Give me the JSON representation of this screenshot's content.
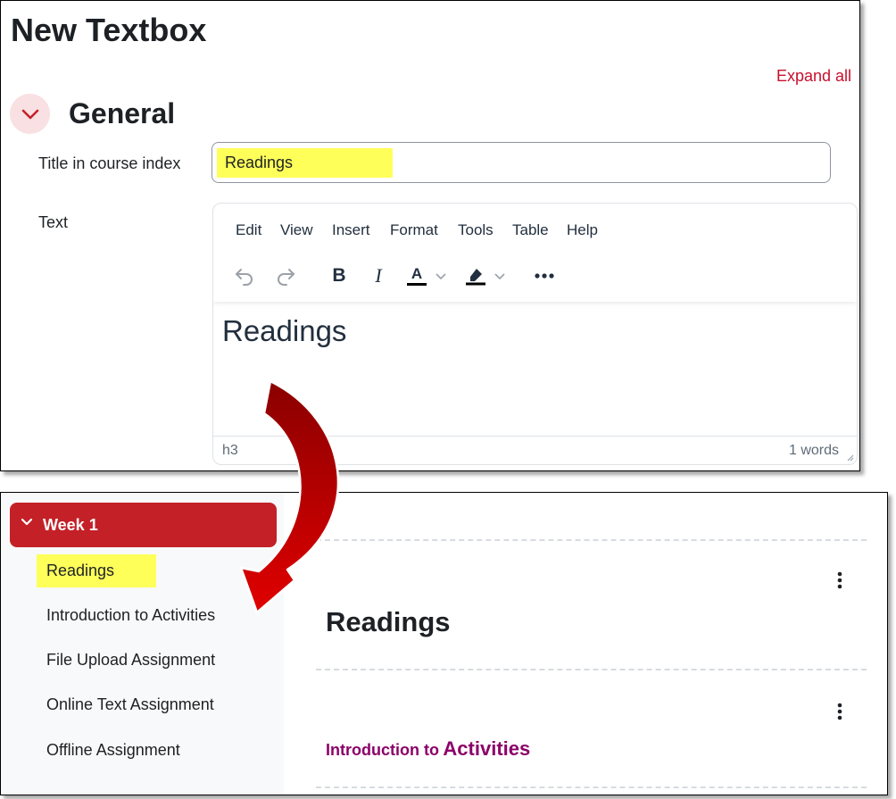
{
  "page_title": "New Textbox",
  "expand_all": "Expand all",
  "section": {
    "title": "General"
  },
  "fields": {
    "title_label": "Title in course index",
    "title_value": "Readings",
    "text_label": "Text"
  },
  "editor": {
    "menus": [
      "Edit",
      "View",
      "Insert",
      "Format",
      "Tools",
      "Table",
      "Help"
    ],
    "toolbar_icons": [
      "undo-icon",
      "redo-icon",
      "bold-icon",
      "italic-icon",
      "text-color-icon",
      "highlight-color-icon",
      "more-icon"
    ],
    "bold_glyph": "B",
    "italic_glyph": "I",
    "text_color_glyph": "A",
    "content_heading": "Readings",
    "status_path": "h3",
    "word_count": "1 words"
  },
  "course_index": {
    "week_label": "Week 1",
    "items": [
      "Readings",
      "Introduction to Activities",
      "File Upload Assignment",
      "Online Text Assignment",
      "Offline Assignment"
    ]
  },
  "course_content": {
    "heading": "Readings",
    "link_part1": "Introduction to",
    "link_part2": "Activities"
  },
  "colors": {
    "accent": "#c32127",
    "highlight": "#ffff5a",
    "link": "#8b0069",
    "arrow": "#c00000"
  }
}
